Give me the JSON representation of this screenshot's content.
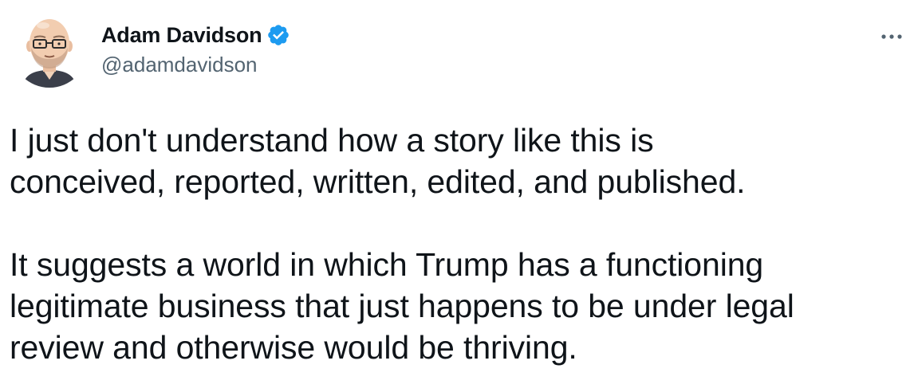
{
  "author": {
    "display_name": "Adam Davidson",
    "handle": "@adamdavidson",
    "verified": true,
    "verified_icon": "verified-badge-icon",
    "avatar_icon": "bald-man-glasses-avatar"
  },
  "tweet": {
    "paragraphs": [
      "I just don't understand how a story like this is\nconceived, reported, written, edited, and published.",
      "It suggests a world in which Trump has a functioning\nlegitimate business that just happens to be under legal\nreview and otherwise would be thriving."
    ]
  },
  "menu": {
    "icon": "more-options-icon"
  },
  "colors": {
    "text": "#0f1419",
    "secondary": "#536471",
    "verified": "#1d9bf0"
  }
}
